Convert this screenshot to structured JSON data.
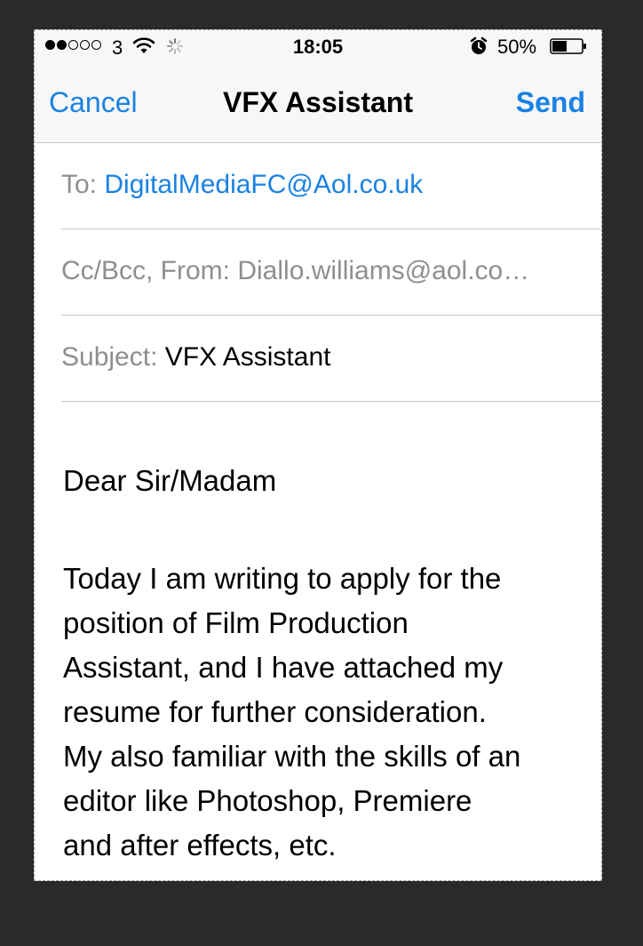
{
  "status_bar": {
    "carrier": "3",
    "time": "18:05",
    "battery": "50%",
    "battery_level": 0.5,
    "signal_bars_filled": 2,
    "signal_bars_total": 5
  },
  "nav": {
    "cancel_label": "Cancel",
    "title": "VFX Assistant",
    "send_label": "Send"
  },
  "fields": {
    "to_label": "To:",
    "to_value": "DigitalMediaFC@Aol.co.uk",
    "cc_label": "Cc/Bcc, From:",
    "cc_value": "Diallo.williams@aol.co…",
    "subject_label": "Subject:",
    "subject_value": "VFX Assistant"
  },
  "body": {
    "greeting": "Dear Sir/Madam",
    "lines": [
      "Today I am writing to apply for the",
      "position of Film Production",
      "Assistant, and I have attached my",
      "resume for further consideration.",
      "My also familiar with the skills of an",
      "editor like Photoshop, Premiere",
      "and after effects, etc."
    ]
  },
  "colors": {
    "accent": "#1a82e2",
    "label_grey": "#8e8e93",
    "bar_background": "#f7f7f7",
    "page_background": "#2a2a2a"
  },
  "icons": [
    "signal-dots-icon",
    "wifi-icon",
    "activity-spinner-icon",
    "alarm-clock-icon",
    "battery-icon"
  ]
}
